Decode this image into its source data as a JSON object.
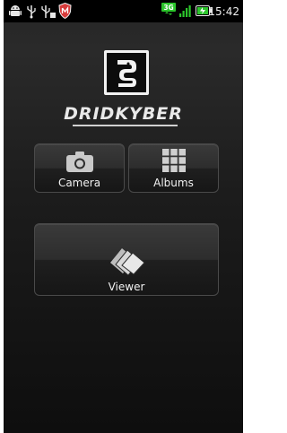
{
  "statusbar": {
    "time": "15:42",
    "icons": [
      "android-icon",
      "usb-icon",
      "usb-debug-icon",
      "shield-icon",
      "3g-icon",
      "signal-icon",
      "battery-icon"
    ]
  },
  "app": {
    "logo_text": "DRIDKYBER"
  },
  "tiles": [
    {
      "label": "Camera",
      "icon": "camera-icon"
    },
    {
      "label": "Albums",
      "icon": "grid-icon"
    },
    {
      "label": "Viewer",
      "icon": "cards-icon"
    }
  ],
  "colors": {
    "background_top": "#2a2a2a",
    "background_bottom": "#0e0e0e",
    "statusbar": "#000000",
    "shield": "#d73b3b",
    "accent_green": "#2cc52c"
  }
}
